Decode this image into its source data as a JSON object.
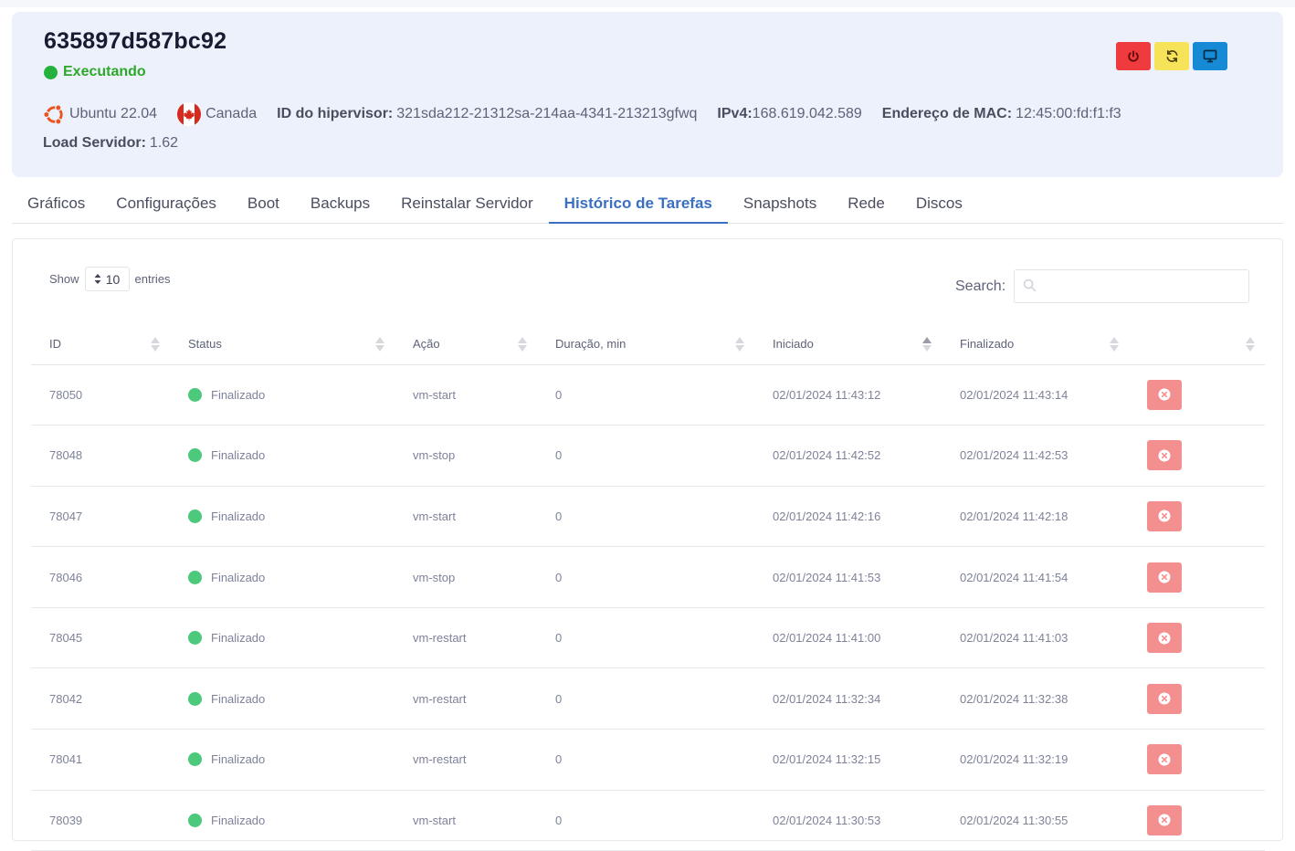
{
  "server": {
    "name": "635897d587bc92",
    "status": "Executando",
    "os": "Ubuntu 22.04",
    "location": "Canada",
    "hypervisor_label": "ID do hipervisor:",
    "hypervisor_id": "321sda212-21312sa-214aa-4341-213213gfwq",
    "ipv4_label": "IPv4:",
    "ipv4": "168.619.042.589",
    "mac_label": "Endereço de MAC:",
    "mac": "12:45:00:fd:f1:f3",
    "load_label": "Load Servidor:",
    "load": "1.62"
  },
  "tabs": [
    {
      "label": "Gráficos"
    },
    {
      "label": "Configurações"
    },
    {
      "label": "Boot"
    },
    {
      "label": "Backups"
    },
    {
      "label": "Reinstalar Servidor"
    },
    {
      "label": "Histórico de Tarefas"
    },
    {
      "label": "Snapshots"
    },
    {
      "label": "Rede"
    },
    {
      "label": "Discos"
    }
  ],
  "active_tab": "Histórico de Tarefas",
  "table": {
    "show_label": "Show",
    "entries_value": "10",
    "entries_label": "entries",
    "search_label": "Search:",
    "search_value": "",
    "columns": [
      "ID",
      "Status",
      "Ação",
      "Duração, min",
      "Iniciado",
      "Finalizado",
      ""
    ],
    "rows": [
      {
        "id": "78050",
        "status": "Finalizado",
        "action": "vm-start",
        "duration": "0",
        "started": "02/01/2024 11:43:12",
        "finished": "02/01/2024 11:43:14"
      },
      {
        "id": "78048",
        "status": "Finalizado",
        "action": "vm-stop",
        "duration": "0",
        "started": "02/01/2024 11:42:52",
        "finished": "02/01/2024 11:42:53"
      },
      {
        "id": "78047",
        "status": "Finalizado",
        "action": "vm-start",
        "duration": "0",
        "started": "02/01/2024 11:42:16",
        "finished": "02/01/2024 11:42:18"
      },
      {
        "id": "78046",
        "status": "Finalizado",
        "action": "vm-stop",
        "duration": "0",
        "started": "02/01/2024 11:41:53",
        "finished": "02/01/2024 11:41:54"
      },
      {
        "id": "78045",
        "status": "Finalizado",
        "action": "vm-restart",
        "duration": "0",
        "started": "02/01/2024 11:41:00",
        "finished": "02/01/2024 11:41:03"
      },
      {
        "id": "78042",
        "status": "Finalizado",
        "action": "vm-restart",
        "duration": "0",
        "started": "02/01/2024 11:32:34",
        "finished": "02/01/2024 11:32:38"
      },
      {
        "id": "78041",
        "status": "Finalizado",
        "action": "vm-restart",
        "duration": "0",
        "started": "02/01/2024 11:32:15",
        "finished": "02/01/2024 11:32:19"
      },
      {
        "id": "78039",
        "status": "Finalizado",
        "action": "vm-start",
        "duration": "0",
        "started": "02/01/2024 11:30:53",
        "finished": "02/01/2024 11:30:55"
      }
    ]
  },
  "colors": {
    "accent": "#3a6fc2",
    "running": "#2ea82a",
    "power_button": "#ef3a3e",
    "restart_button": "#f7e35a",
    "console_button": "#168ad4",
    "delete_button": "#f48f90"
  },
  "icons": {
    "power": "power-icon",
    "restart": "refresh-icon",
    "console": "monitor-icon",
    "os": "ubuntu-logo-icon",
    "flag": "canada-flag-icon",
    "search": "search-icon",
    "delete": "close-circle-icon"
  }
}
